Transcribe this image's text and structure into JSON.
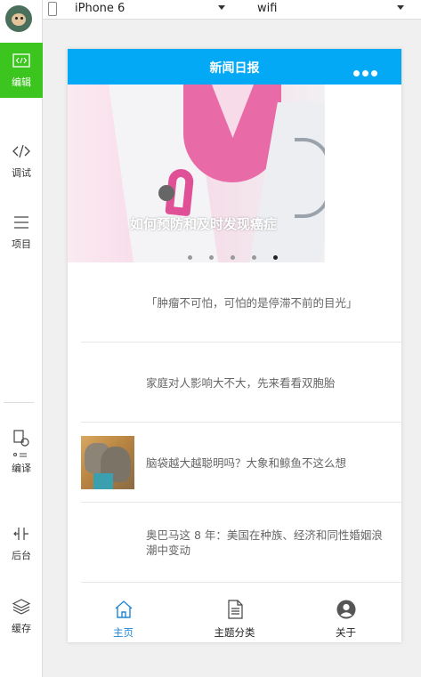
{
  "sidebar": {
    "items": [
      {
        "label": "编辑",
        "icon": "code-icon"
      },
      {
        "label": "调试",
        "icon": "debug-icon"
      },
      {
        "label": "项目",
        "icon": "menu-icon"
      },
      {
        "label": "编译",
        "icon": "compile-icon"
      },
      {
        "label": "后台",
        "icon": "background-icon"
      },
      {
        "label": "缓存",
        "icon": "layers-icon"
      }
    ]
  },
  "toolbar": {
    "device": "iPhone 6",
    "network": "wifi"
  },
  "app": {
    "title": "新闻日报",
    "banner": {
      "title": "如何预防和及时发现癌症",
      "slide_count": 5,
      "active_slide": 5
    },
    "news": [
      {
        "title": "「肿瘤不可怕，可怕的是停滞不前的目光」",
        "has_thumb": false
      },
      {
        "title": "家庭对人影响大不大，先来看看双胞胎",
        "has_thumb": false
      },
      {
        "title": "脑袋越大越聪明吗？大象和鲸鱼不这么想",
        "has_thumb": true
      },
      {
        "title": "奥巴马这 8 年：美国在种族、经济和同性婚姻浪潮中变动",
        "has_thumb": false
      }
    ],
    "tabs": [
      {
        "label": "主页",
        "icon": "home-icon",
        "active": true
      },
      {
        "label": "主题分类",
        "icon": "document-icon",
        "active": false
      },
      {
        "label": "关于",
        "icon": "user-icon",
        "active": false
      }
    ],
    "colors": {
      "navbar": "#03a9f4",
      "active_sidebar": "#3cc51f",
      "active_tab": "#1f87d6"
    }
  }
}
